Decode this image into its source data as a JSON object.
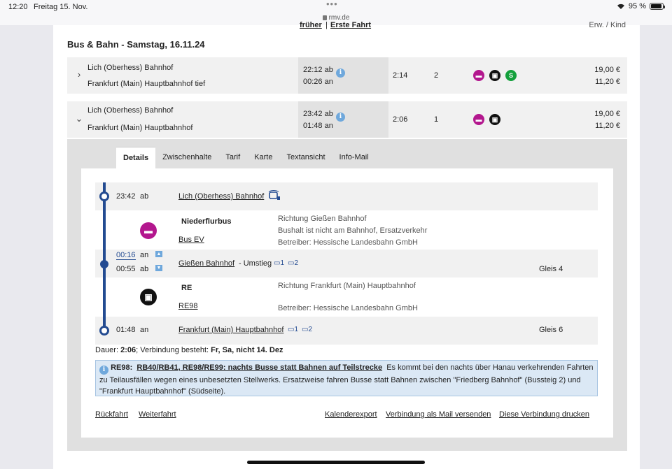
{
  "status": {
    "time": "12:20",
    "date": "Freitag 15. Nov.",
    "dots": "•••",
    "battery": "95 %",
    "battery_level": 0.95
  },
  "browser": {
    "url": "rmv.de"
  },
  "nav_cut": {
    "earlier": "früher",
    "sep": "|",
    "first": "Erste Fahrt",
    "price_hdr": "Erw. / Kind"
  },
  "section": {
    "title": "Bus & Bahn - Samstag, 16.11.24"
  },
  "connections": [
    {
      "from": "Lich (Oberhess) Bahnhof",
      "to": "Frankfurt (Main) Hauptbahnhof tief",
      "dep": "22:12 ab",
      "arr": "00:26 an",
      "duration": "2:14",
      "changes": "2",
      "price_adult": "19,00 €",
      "price_child": "11,20 €",
      "chevron": "›"
    },
    {
      "from": "Lich (Oberhess) Bahnhof",
      "to": "Frankfurt (Main) Hauptbahnhof",
      "dep": "23:42 ab",
      "arr": "01:48 an",
      "duration": "2:06",
      "changes": "1",
      "price_adult": "19,00 €",
      "price_child": "11,20 €",
      "chevron": "⌄"
    }
  ],
  "tabs": [
    "Details",
    "Zwischenhalte",
    "Tarif",
    "Karte",
    "Textansicht",
    "Info-Mail"
  ],
  "detail": {
    "stop1": {
      "time": "23:42",
      "type": "ab",
      "name": "Lich (Oberhess) Bahnhof"
    },
    "leg1": {
      "product": "Niederflurbus",
      "line": "Bus EV",
      "direction": "Richtung Gießen Bahnhof",
      "note": "Bushalt ist nicht am Bahnhof, Ersatzverkehr",
      "operator": "Betreiber: Hessische Landesbahn GmbH"
    },
    "stop2": {
      "time_arr": "00:16",
      "type_arr": "an",
      "time_dep": "00:55",
      "type_dep": "ab",
      "name": "Gießen Bahnhof",
      "change": "- Umstieg",
      "p1": "1",
      "p2": "2",
      "platform": "Gleis 4"
    },
    "leg2": {
      "product": "RE",
      "line": "RE98",
      "direction": "Richtung Frankfurt (Main) Hauptbahnhof",
      "operator": "Betreiber: Hessische Landesbahn GmbH"
    },
    "stop3": {
      "time": "01:48",
      "type": "an",
      "name": "Frankfurt (Main) Hauptbahnhof",
      "p1": "1",
      "p2": "2",
      "platform": "Gleis 6"
    }
  },
  "dauer": {
    "label": "Dauer: ",
    "value": "2:06",
    "mid": "; Verbindung besteht: ",
    "days": "Fr, Sa, nicht 14. Dez"
  },
  "notice": {
    "code": "RE98:",
    "title": "RB40/RB41, RE98/RE99: nachts Busse statt Bahnen auf Teilstrecke",
    "text": "Es kommt bei den nachts über Hanau verkehrenden Fahrten zu Teilausfällen wegen eines unbesetzten Stellwerks. Ersatzweise fahren Busse statt Bahnen zwischen \"Friedberg Bahnhof\" (Bussteig 2) und \"Frankfurt Hauptbahnhof\" (Südseite)."
  },
  "links": {
    "back": "Rückfahrt",
    "next": "Weiterfahrt",
    "calendar": "Kalenderexport",
    "mail": "Verbindung als Mail versenden",
    "print": "Diese Verbindung drucken"
  },
  "icons": {
    "info": "info-icon",
    "bus": "bus-icon",
    "rail": "regional-train-icon",
    "sbahn": "s-bahn-icon",
    "wifi": "wifi-icon",
    "battery": "battery-icon",
    "lock": "lock-icon"
  },
  "colors": {
    "accent": "#234b91",
    "bus": "#b3178e",
    "sbahn": "#14a03c",
    "info": "#6fa8dc"
  }
}
